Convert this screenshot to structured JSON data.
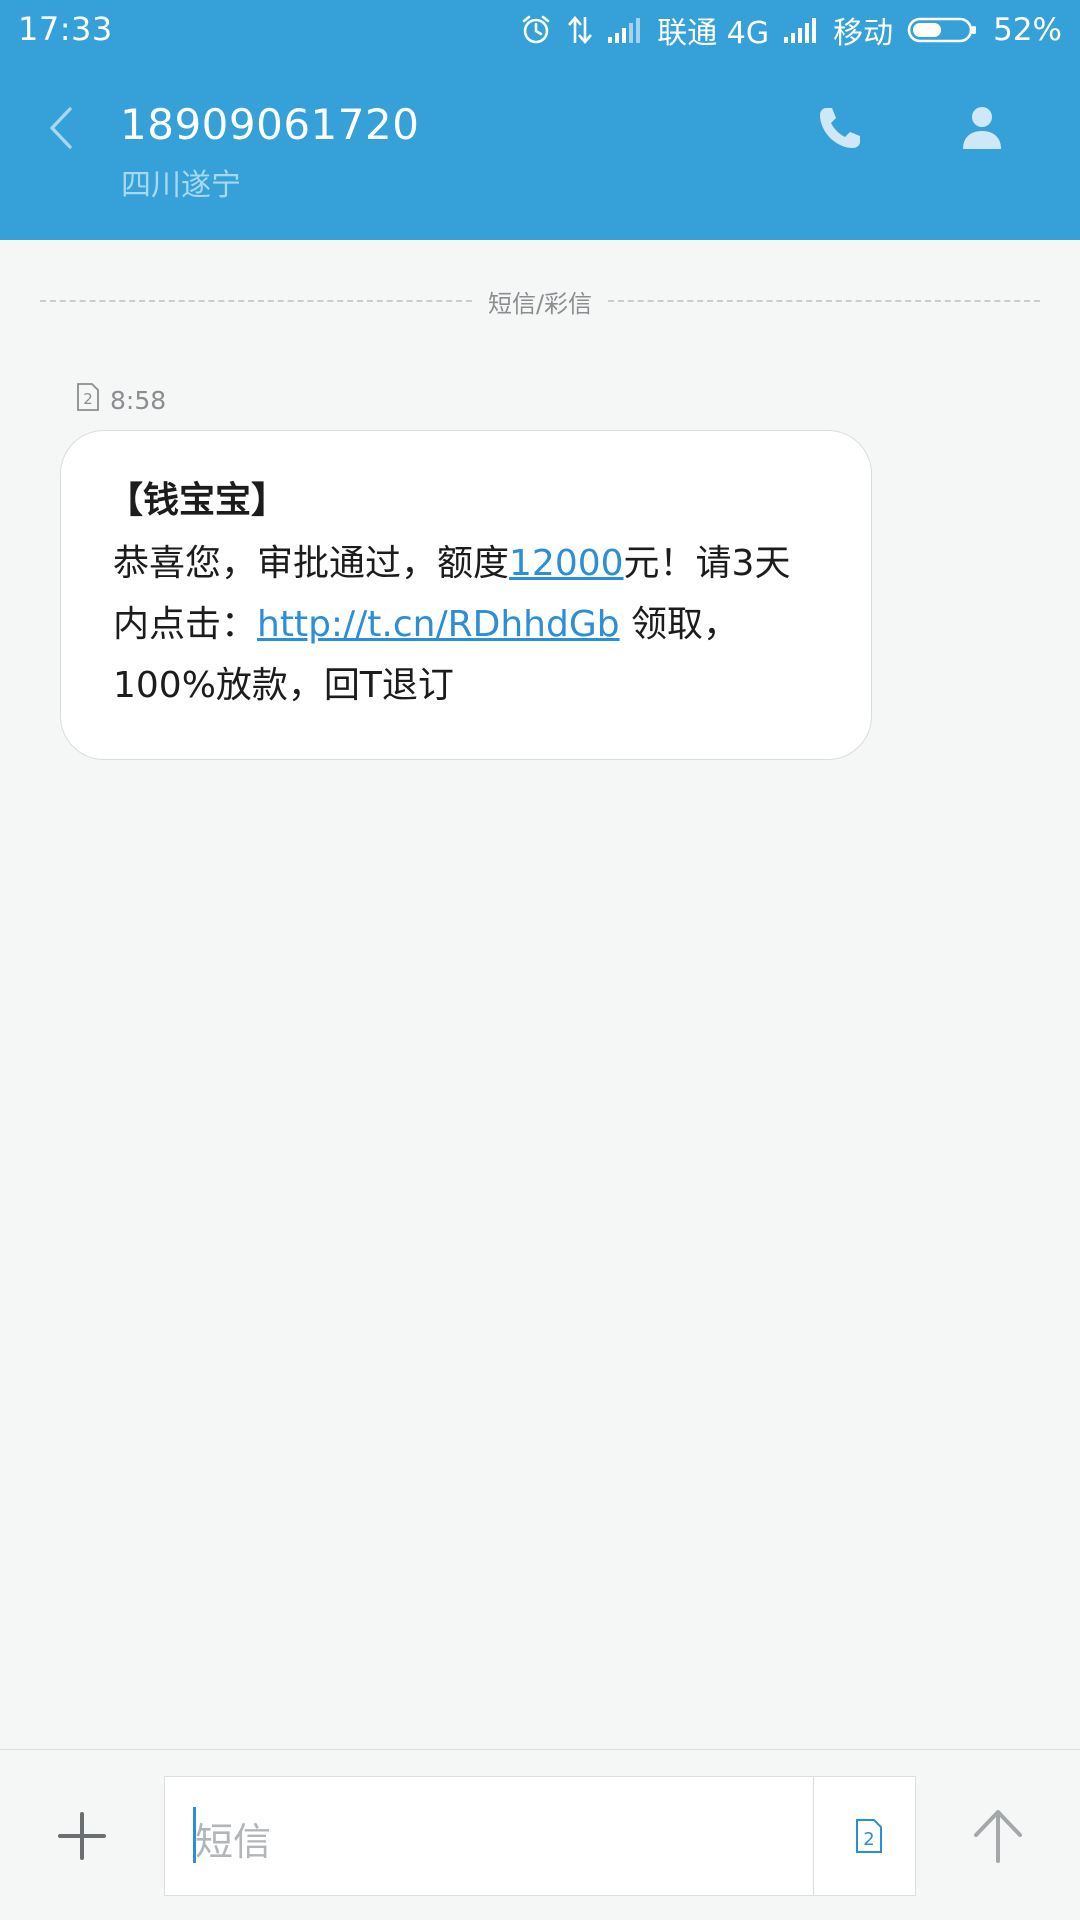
{
  "status_bar": {
    "time": "17:33",
    "carrier1": "联通 4G",
    "carrier2": "移动",
    "battery_percent": "52%",
    "battery_level": 0.52,
    "icons": [
      "alarm-icon",
      "data-transfer-icon",
      "signal-icon",
      "battery-icon"
    ]
  },
  "header": {
    "contact_number": "18909061720",
    "contact_location": "四川遂宁",
    "icons": [
      "back-icon",
      "phone-icon",
      "contact-icon"
    ]
  },
  "conversation": {
    "divider_label": "短信/彩信",
    "message": {
      "sim_slot": "2",
      "time": "8:58",
      "sender_tag": "【钱宝宝】",
      "body_part1": "恭喜您，审批通过，额度",
      "amount_link": "12000",
      "body_part2": "元！请3天内点击：",
      "url_link": "http://t.cn/RDhhdGb",
      "body_part3": " 领取，100%放款，回T退订"
    }
  },
  "compose": {
    "placeholder": "短信",
    "sim_slot": "2",
    "icons": [
      "add-icon",
      "sim-card-icon",
      "send-icon"
    ]
  },
  "colors": {
    "header_bg": "#35a1d8",
    "link": "#2a8ed8",
    "background": "#f5f6f6"
  }
}
